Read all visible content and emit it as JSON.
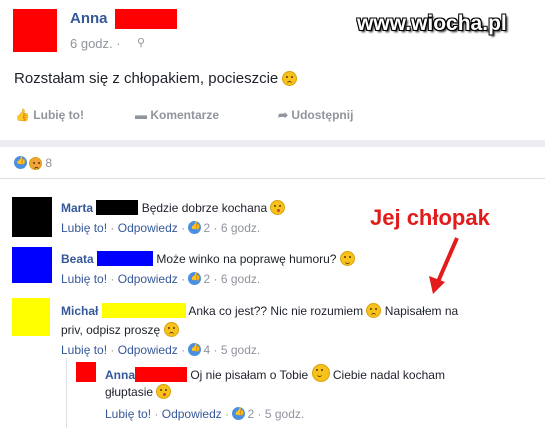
{
  "watermark": "www.wiocha.pl",
  "post": {
    "author": "Anna",
    "time": "6 godz. ·",
    "text": "Rozstałam się z chłopakiem, pocieszcie",
    "actions": {
      "like": "Lubię to!",
      "comment": "Komentarze",
      "share": "Udostępnij"
    },
    "reactions_count": "8"
  },
  "annotation": "Jej chłopak",
  "comments": [
    {
      "author": "Marta",
      "text": "Będzie dobrze kochana",
      "like": "Lubię to!",
      "reply": "Odpowiedz",
      "likes": "2",
      "time": "6 godz."
    },
    {
      "author": "Beata",
      "text": "Może winko na poprawę humoru?",
      "like": "Lubię to!",
      "reply": "Odpowiedz",
      "likes": "2",
      "time": "6 godz."
    },
    {
      "author": "Michał",
      "text1": "Anka co jest?? Nic nie rozumiem",
      "text2": "Napisałem na",
      "text3": "priv, odpisz proszę",
      "like": "Lubię to!",
      "reply": "Odpowiedz",
      "likes": "4",
      "time": "5 godz."
    },
    {
      "author": "Anna",
      "text1": "Oj nie pisałam o Tobie",
      "text2": "Ciebie nadal kocham",
      "text3": "głuptasie",
      "like": "Lubię to!",
      "reply": "Odpowiedz",
      "likes": "2",
      "time": "5 godz."
    }
  ],
  "colors": {
    "link": "#365899",
    "muted": "#90949c",
    "annotation": "#e21b1b",
    "avatar1": "#ff0000",
    "avatar_marta": "#000000",
    "avatar_beata": "#0000ff",
    "avatar_michal": "#ffff00"
  }
}
